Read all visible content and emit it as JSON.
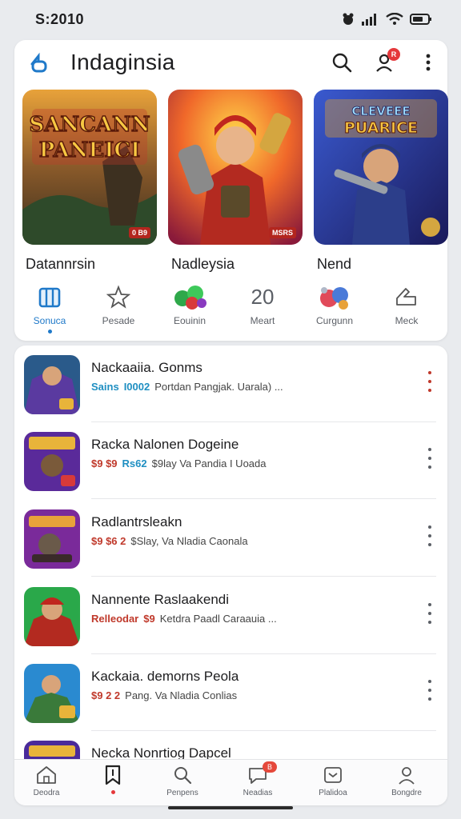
{
  "status_bar": {
    "time": "S:2010",
    "icons": [
      "bug-icon",
      "signal-icon",
      "wifi-icon",
      "battery-icon"
    ]
  },
  "header": {
    "title": "Indaginsia",
    "icons": [
      "search-icon",
      "profile-icon",
      "more-vertical-icon"
    ],
    "badge": "R"
  },
  "featured": [
    {
      "label": "Datannrsin",
      "art_text": "SANCANN PANEICI",
      "tag": "0 B9"
    },
    {
      "label": "Nadleysia",
      "art_text": "",
      "tag": "MSRS"
    },
    {
      "label": "Nend",
      "art_text": "CLEVEEE PUARICE",
      "tag": ""
    }
  ],
  "categories": [
    {
      "label": "Sonuca",
      "icon": "building-icon",
      "active": true
    },
    {
      "label": "Pesade",
      "icon": "star-outline-icon",
      "active": false
    },
    {
      "label": "Eouinin",
      "icon": "gems-icon",
      "active": false
    },
    {
      "label": "Meart",
      "number": "20",
      "active": false
    },
    {
      "label": "Curgunn",
      "icon": "potion-icon",
      "active": false
    },
    {
      "label": "Meck",
      "icon": "hand-icon",
      "active": false
    }
  ],
  "games": [
    {
      "title": "Nackaaiia. Gonms",
      "meta_a": "Sains",
      "meta_b": "I0002",
      "meta_text": "Portdan Pangjak. Uarala) ..."
    },
    {
      "title": "Racka Nalonen Dogeine",
      "meta_a": "$9 $9",
      "meta_b": "Rs62",
      "meta_text": "$9lay Va Pandia I Uoada"
    },
    {
      "title": "Radlantrsleakn",
      "meta_a": "$9 $6 2",
      "meta_b": "",
      "meta_text": "$Slay, Va Nladia Caonala"
    },
    {
      "title": "Nannente Raslaakendi",
      "meta_a": "Relleodar",
      "meta_b": "$9",
      "meta_text": "Ketdra Paadl Caraauia ..."
    },
    {
      "title": "Kackaia. demorns Peola",
      "meta_a": "$9 2 2",
      "meta_b": "",
      "meta_text": "Pang. Va Nladia Conlias"
    },
    {
      "title": "Necka Nonrtiog Dapcel",
      "meta_a": "",
      "meta_b": "",
      "meta_text": ""
    }
  ],
  "bottom_nav": [
    {
      "label": "Deodra",
      "icon": "home-icon"
    },
    {
      "label": "",
      "icon": "bookmark-icon",
      "active": true
    },
    {
      "label": "Penpens",
      "icon": "search-icon"
    },
    {
      "label": "Neadias",
      "icon": "chat-icon",
      "badge": "B"
    },
    {
      "label": "Plalidoa",
      "icon": "library-icon"
    },
    {
      "label": "Bongdre",
      "icon": "profile-icon"
    }
  ],
  "colors": {
    "accent": "#1f79c9",
    "badge": "#e5383b",
    "card": "#ffffff",
    "background": "#e9ebee"
  }
}
